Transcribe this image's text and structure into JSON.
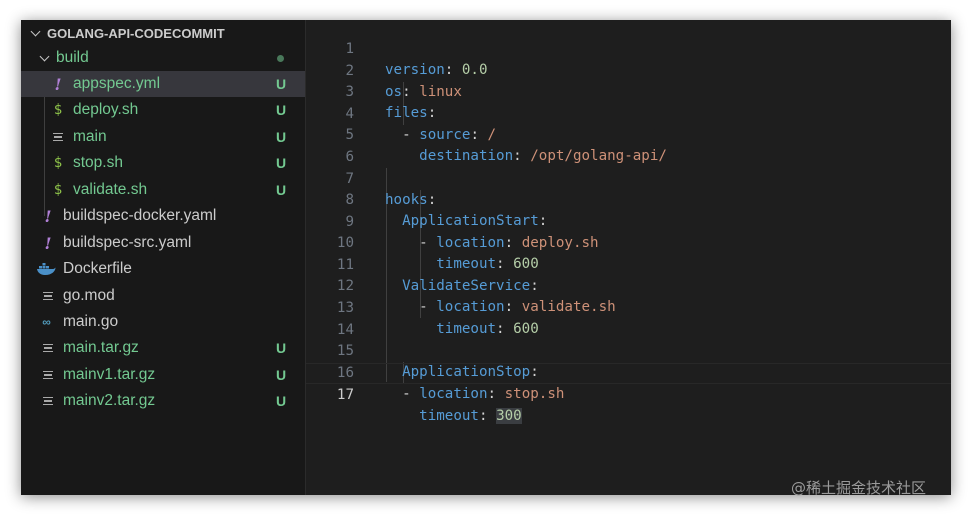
{
  "explorer": {
    "title": "GOLANG-API-CODECOMMIT",
    "items": [
      {
        "label": "build",
        "badge": "",
        "icon": "chevron-down-icon"
      },
      {
        "label": "appspec.yml",
        "badge": "U",
        "icon": "yaml-icon"
      },
      {
        "label": "deploy.sh",
        "badge": "U",
        "icon": "shell-icon"
      },
      {
        "label": "main",
        "badge": "U",
        "icon": "file-icon"
      },
      {
        "label": "stop.sh",
        "badge": "U",
        "icon": "shell-icon"
      },
      {
        "label": "validate.sh",
        "badge": "U",
        "icon": "shell-icon"
      },
      {
        "label": "buildspec-docker.yaml",
        "badge": "",
        "icon": "yaml-icon"
      },
      {
        "label": "buildspec-src.yaml",
        "badge": "",
        "icon": "yaml-icon"
      },
      {
        "label": "Dockerfile",
        "badge": "",
        "icon": "docker-icon"
      },
      {
        "label": "go.mod",
        "badge": "",
        "icon": "file-icon"
      },
      {
        "label": "main.go",
        "badge": "",
        "icon": "go-icon"
      },
      {
        "label": "main.tar.gz",
        "badge": "U",
        "icon": "file-icon"
      },
      {
        "label": "mainv1.tar.gz",
        "badge": "U",
        "icon": "file-icon"
      },
      {
        "label": "mainv2.tar.gz",
        "badge": "U",
        "icon": "file-icon"
      }
    ]
  },
  "editor": {
    "line_numbers": [
      "1",
      "2",
      "3",
      "4",
      "5",
      "6",
      "7",
      "8",
      "9",
      "10",
      "11",
      "12",
      "13",
      "14",
      "15",
      "16",
      "17"
    ],
    "current_line": "17",
    "tokens": {
      "l1_key": "version",
      "l1_val": "0.0",
      "l2_key": "os",
      "l2_val": "linux",
      "l3_key": "files",
      "l4_dash": "-",
      "l4_key": "source",
      "l4_val": "/",
      "l5_key": "destination",
      "l5_val": "/opt/golang-api/",
      "l7_key": "hooks",
      "l8_key": "ApplicationStart",
      "l9_dash": "-",
      "l9_key": "location",
      "l9_val": "deploy.sh",
      "l10_key": "timeout",
      "l10_val": "600",
      "l11_key": "ValidateService",
      "l12_dash": "-",
      "l12_key": "location",
      "l12_val": "validate.sh",
      "l13_key": "timeout",
      "l13_val": "600",
      "l15_key": "ApplicationStop",
      "l16_dash": "-",
      "l16_key": "location",
      "l16_val": "stop.sh",
      "l17_key": "timeout",
      "l17_val": "300",
      "colon": ":"
    }
  },
  "watermark": "@稀土掘金技术社区",
  "colors": {
    "accent_untracked": "#73c991",
    "yaml_key": "#569cd6",
    "yaml_string": "#ce9178",
    "yaml_number": "#b5cea8"
  }
}
